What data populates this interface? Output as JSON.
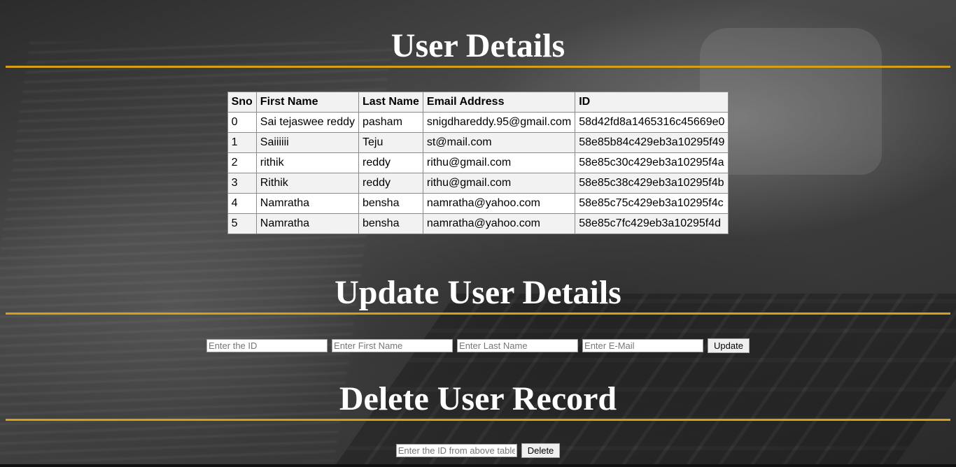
{
  "users_section": {
    "title": "User Details",
    "columns": [
      "Sno",
      "First Name",
      "Last Name",
      "Email Address",
      "ID"
    ],
    "rows": [
      [
        "0",
        "Sai tejaswee reddy",
        "pasham",
        "snigdhareddy.95@gmail.com",
        "58d42fd8a1465316c45669e0"
      ],
      [
        "1",
        "Saiiiiii",
        "Teju",
        "st@mail.com",
        "58e85b84c429eb3a10295f49"
      ],
      [
        "2",
        "rithik",
        "reddy",
        "rithu@gmail.com",
        "58e85c30c429eb3a10295f4a"
      ],
      [
        "3",
        "Rithik",
        "reddy",
        "rithu@gmail.com",
        "58e85c38c429eb3a10295f4b"
      ],
      [
        "4",
        "Namratha",
        "bensha",
        "namratha@yahoo.com",
        "58e85c75c429eb3a10295f4c"
      ],
      [
        "5",
        "Namratha",
        "bensha",
        "namratha@yahoo.com",
        "58e85c7fc429eb3a10295f4d"
      ]
    ]
  },
  "update_section": {
    "title": "Update User Details",
    "id_placeholder": "Enter the ID",
    "first_name_placeholder": "Enter First Name",
    "last_name_placeholder": "Enter Last Name",
    "email_placeholder": "Enter E-Mail",
    "button_label": "Update"
  },
  "delete_section": {
    "title": "Delete User Record",
    "id_placeholder": "Enter the ID from above table",
    "button_label": "Delete"
  },
  "colors": {
    "accent_rule": "#d4a017",
    "heading_text": "#ffffff"
  }
}
